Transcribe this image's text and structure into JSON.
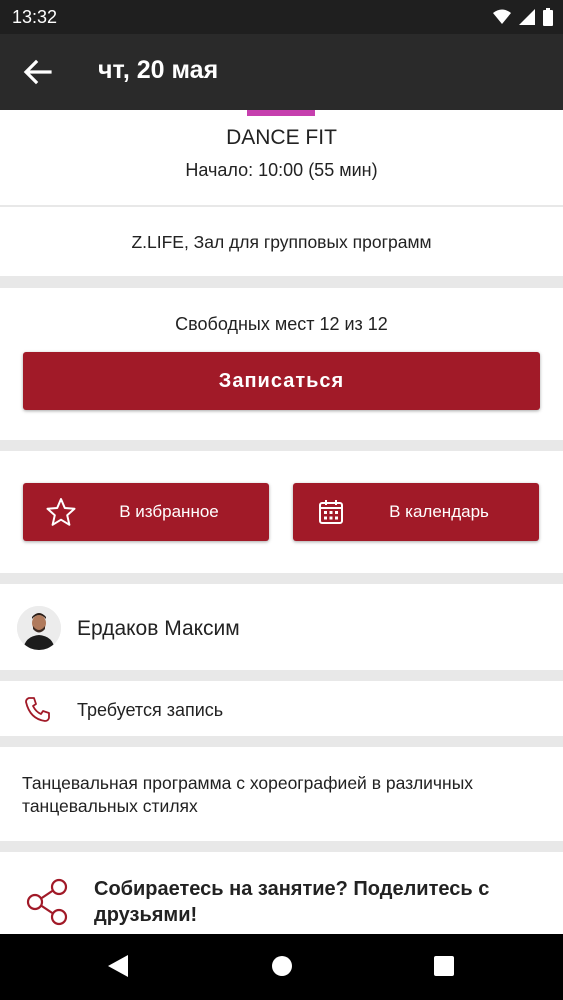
{
  "status_bar": {
    "time": "13:32"
  },
  "app_bar": {
    "title": "чт, 20 мая"
  },
  "class_info": {
    "name": "DANCE FIT",
    "start": "Начало: 10:00 (55 мин)",
    "accent_color": "#c63fae"
  },
  "location": "Z.LIFE, Зал для групповых программ",
  "booking": {
    "seats_text": "Свободных мест 12 из 12",
    "signup_label": "Записаться"
  },
  "actions": {
    "favorite_label": "В избранное",
    "calendar_label": "В календарь"
  },
  "trainer": {
    "name": "Ердаков Максим"
  },
  "requirement": "Требуется запись",
  "description": "Танцевальная программа с хореографией в различных танцевальных стилях",
  "share": {
    "text": "Собираетесь на занятие? Поделитесь с друзьями!"
  },
  "colors": {
    "primary": "#a11a28",
    "appbar": "#2a2a2a"
  },
  "icons": {
    "back": "arrow-left-icon",
    "favorite": "star-icon",
    "calendar": "calendar-icon",
    "phone": "phone-icon",
    "share": "share-icon"
  }
}
